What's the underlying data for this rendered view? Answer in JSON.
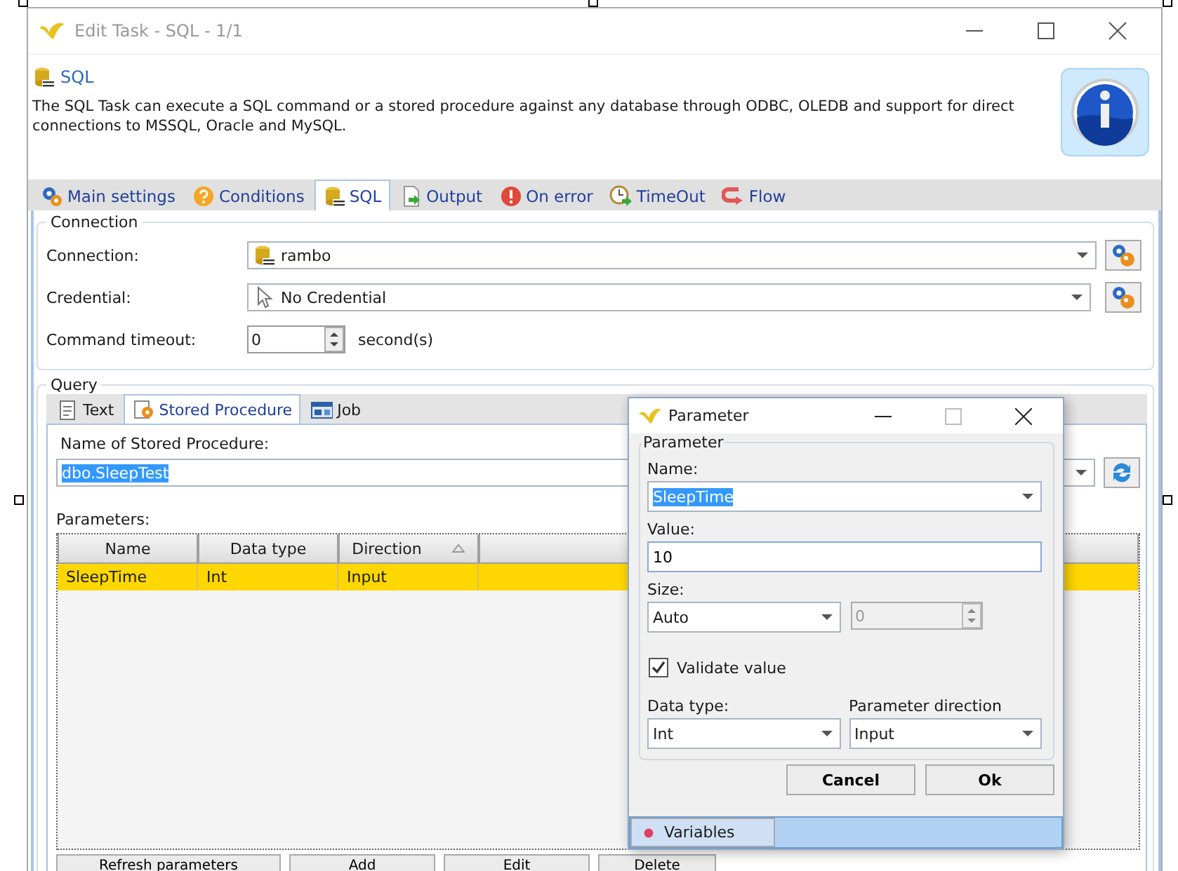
{
  "window": {
    "title": "Edit Task - SQL - 1/1"
  },
  "header": {
    "title": "SQL",
    "description": "The SQL Task can execute a SQL command or a stored procedure against any database through ODBC, OLEDB and support for direct connections to MSSQL, Oracle and MySQL."
  },
  "tabs": [
    {
      "label": "Main settings",
      "kind": "gear",
      "selected": false
    },
    {
      "label": "Conditions",
      "kind": "question",
      "selected": false
    },
    {
      "label": "SQL",
      "kind": "sql",
      "selected": true
    },
    {
      "label": "Output",
      "kind": "output",
      "selected": false
    },
    {
      "label": "On error",
      "kind": "error",
      "selected": false
    },
    {
      "label": "TimeOut",
      "kind": "clock",
      "selected": false
    },
    {
      "label": "Flow",
      "kind": "flow",
      "selected": false
    }
  ],
  "connection": {
    "legend": "Connection",
    "fields": [
      {
        "label": "Connection:",
        "value": "rambo",
        "kind": "sql"
      },
      {
        "label": "Credential:",
        "value": "No Credential",
        "kind": "pointer"
      }
    ],
    "timeout": {
      "label": "Command timeout:",
      "value": "0",
      "unit": "second(s)"
    }
  },
  "query": {
    "legend": "Query",
    "tabs": [
      {
        "label": "Text",
        "kind": "text",
        "selected": false
      },
      {
        "label": "Stored Procedure",
        "kind": "procedure",
        "selected": true
      },
      {
        "label": "Job",
        "kind": "job",
        "selected": false
      }
    ],
    "procedure_label": "Name of Stored Procedure:",
    "procedure": "dbo.SleepTest",
    "procedure_highlighted": true,
    "parameters_label": "Parameters:",
    "columns": [
      {
        "label": "Name",
        "sorted": false
      },
      {
        "label": "Data type",
        "sorted": false
      },
      {
        "label": "Direction",
        "sorted": true
      }
    ],
    "rows": [
      {
        "cells": [
          "SleepTime",
          "Int",
          "Input"
        ],
        "selected": true
      }
    ],
    "buttons": [
      "Refresh parameters",
      "Add",
      "Edit",
      "Delete"
    ]
  },
  "dialog": {
    "title": "Parameter",
    "group": "Parameter",
    "name_label": "Name:",
    "name": "SleepTime",
    "name_highlighted": true,
    "value_label": "Value:",
    "value": "10",
    "size_label": "Size:",
    "size": "Auto",
    "size_value": "0",
    "size_value_disabled": true,
    "validate": {
      "label": "Validate value",
      "checked": true
    },
    "type_label": "Data type:",
    "type": "Int",
    "direction_label": "Parameter direction",
    "direction": "Input",
    "buttons": [
      "Cancel",
      "Ok"
    ],
    "bottom_tabs": [
      {
        "label": "Variables"
      }
    ]
  }
}
